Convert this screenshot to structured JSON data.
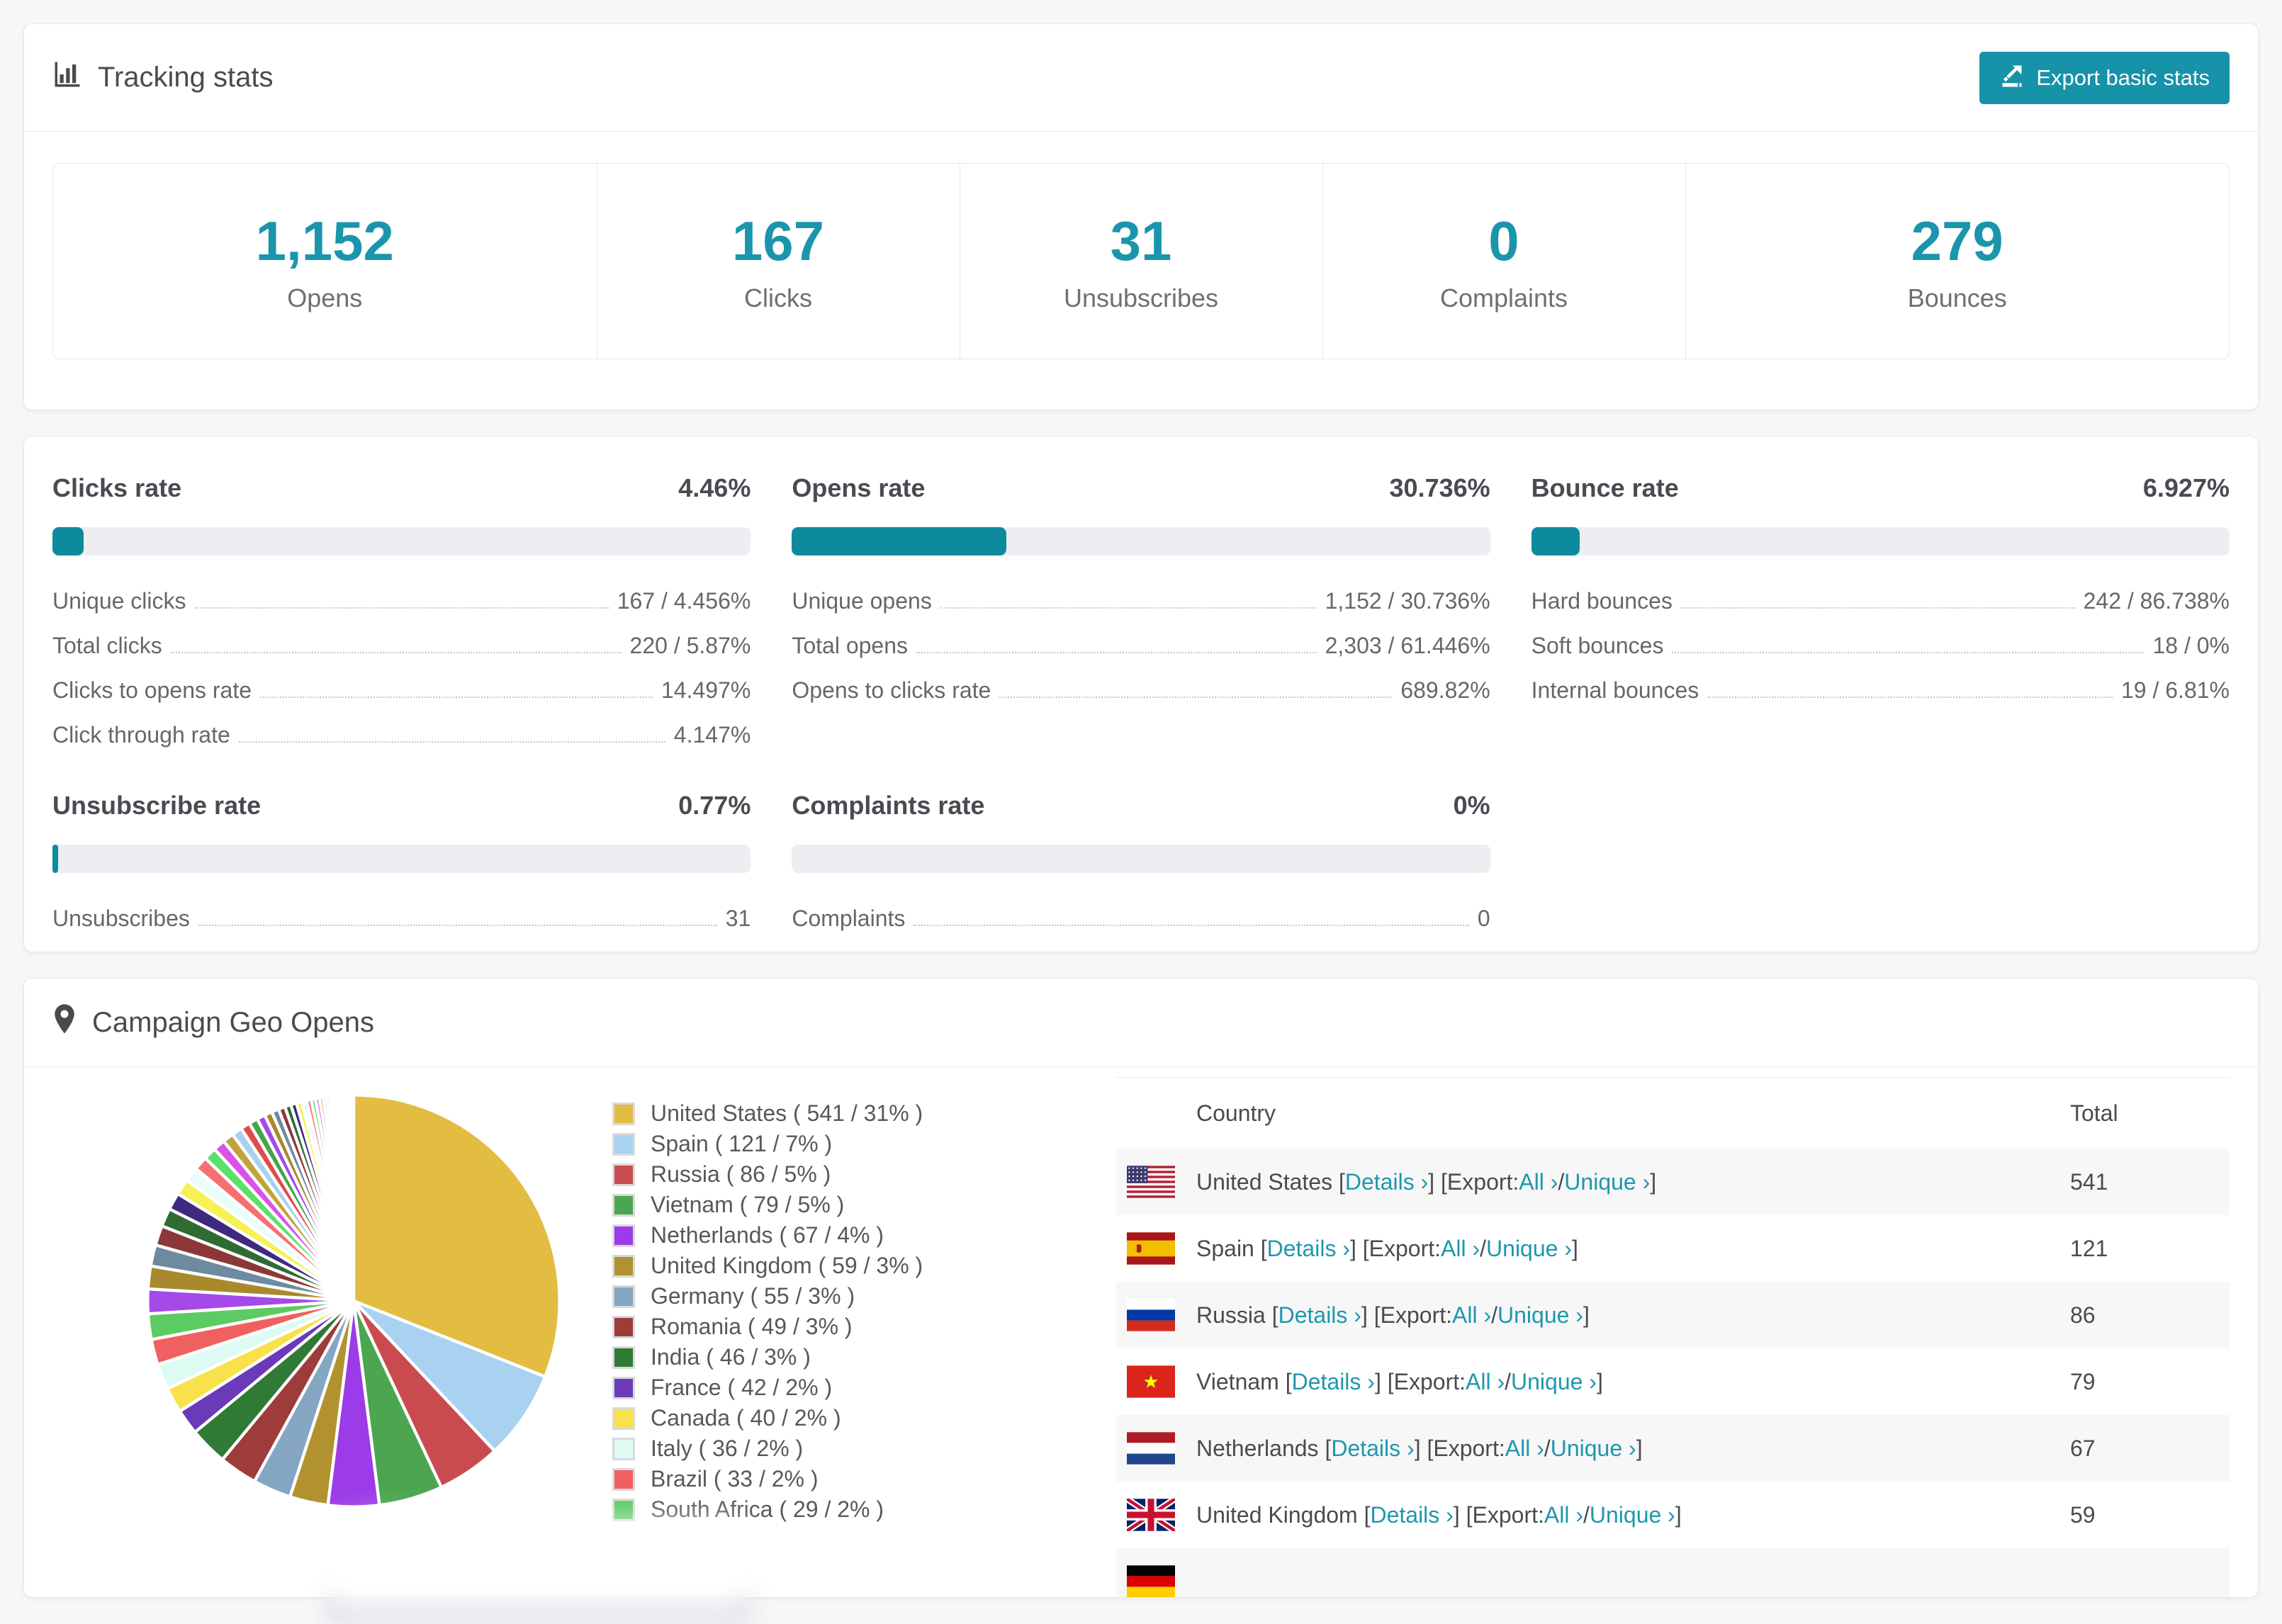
{
  "tracking": {
    "title": "Tracking stats",
    "export_label": "Export basic stats",
    "stats": [
      {
        "value": "1,152",
        "label": "Opens"
      },
      {
        "value": "167",
        "label": "Clicks"
      },
      {
        "value": "31",
        "label": "Unsubscribes"
      },
      {
        "value": "0",
        "label": "Complaints"
      },
      {
        "value": "279",
        "label": "Bounces"
      }
    ]
  },
  "rates": [
    {
      "title": "Clicks rate",
      "value": "4.46%",
      "percent": 4.46,
      "rows": [
        {
          "label": "Unique clicks",
          "value": "167 / 4.456%"
        },
        {
          "label": "Total clicks",
          "value": "220 / 5.87%"
        },
        {
          "label": "Clicks to opens rate",
          "value": "14.497%"
        },
        {
          "label": "Click through rate",
          "value": "4.147%"
        }
      ]
    },
    {
      "title": "Opens rate",
      "value": "30.736%",
      "percent": 30.736,
      "rows": [
        {
          "label": "Unique opens",
          "value": "1,152 / 30.736%"
        },
        {
          "label": "Total opens",
          "value": "2,303 / 61.446%"
        },
        {
          "label": "Opens to clicks rate",
          "value": "689.82%"
        }
      ]
    },
    {
      "title": "Bounce rate",
      "value": "6.927%",
      "percent": 6.927,
      "rows": [
        {
          "label": "Hard bounces",
          "value": "242 / 86.738%"
        },
        {
          "label": "Soft bounces",
          "value": "18 / 0%"
        },
        {
          "label": "Internal bounces",
          "value": "19 / 6.81%"
        }
      ]
    },
    {
      "title": "Unsubscribe rate",
      "value": "0.77%",
      "percent": 0.77,
      "rows": [
        {
          "label": "Unsubscribes",
          "value": "31"
        }
      ]
    },
    {
      "title": "Complaints rate",
      "value": "0%",
      "percent": 0,
      "rows": [
        {
          "label": "Complaints",
          "value": "0"
        }
      ]
    }
  ],
  "geo": {
    "title": "Campaign Geo Opens",
    "chart_data": {
      "type": "pie",
      "title": "Campaign Geo Opens",
      "start_angle_deg": 0,
      "direction": "clockwise",
      "legend_position": "right",
      "series": [
        {
          "name": "United States",
          "value": 541,
          "percent": 31,
          "color": "#E3BC42"
        },
        {
          "name": "Spain",
          "value": 121,
          "percent": 7,
          "color": "#A8D2F0"
        },
        {
          "name": "Russia",
          "value": 86,
          "percent": 5,
          "color": "#C94B50"
        },
        {
          "name": "Vietnam",
          "value": 79,
          "percent": 5,
          "color": "#4CA64F"
        },
        {
          "name": "Netherlands",
          "value": 67,
          "percent": 4,
          "color": "#9C3BE8"
        },
        {
          "name": "United Kingdom",
          "value": 59,
          "percent": 3,
          "color": "#B2922F"
        },
        {
          "name": "Germany",
          "value": 55,
          "percent": 3,
          "color": "#84A6C2"
        },
        {
          "name": "Romania",
          "value": 49,
          "percent": 3,
          "color": "#9E3B3B"
        },
        {
          "name": "India",
          "value": 46,
          "percent": 3,
          "color": "#2F7A34"
        },
        {
          "name": "France",
          "value": 42,
          "percent": 2,
          "color": "#6B3AB8"
        },
        {
          "name": "Canada",
          "value": 40,
          "percent": 2,
          "color": "#F8E14B"
        },
        {
          "name": "Italy",
          "value": 36,
          "percent": 2,
          "color": "#DDFBF3"
        },
        {
          "name": "Brazil",
          "value": 33,
          "percent": 2,
          "color": "#F06060"
        },
        {
          "name": "South Africa",
          "value": 29,
          "percent": 2,
          "color": "#5BCB62"
        }
      ],
      "others_total_percent": 26,
      "others_palette": [
        "#A44AE8",
        "#A8892C",
        "#6E8AA0",
        "#8C3838",
        "#2F6B33",
        "#3F2A80",
        "#F6F155",
        "#EAFDFB",
        "#F77070",
        "#5DE06A",
        "#DA52E8",
        "#C2A23A",
        "#A8D1F0",
        "#E04B4B",
        "#47A34C"
      ]
    },
    "legend": [
      {
        "label": "United States ( 541 / 31% )",
        "color": "#E3BC42"
      },
      {
        "label": "Spain ( 121 / 7% )",
        "color": "#A8D2F0"
      },
      {
        "label": "Russia ( 86 / 5% )",
        "color": "#C94B50"
      },
      {
        "label": "Vietnam ( 79 / 5% )",
        "color": "#4CA64F"
      },
      {
        "label": "Netherlands ( 67 / 4% )",
        "color": "#9C3BE8"
      },
      {
        "label": "United Kingdom ( 59 / 3% )",
        "color": "#B2922F"
      },
      {
        "label": "Germany ( 55 / 3% )",
        "color": "#84A6C2"
      },
      {
        "label": "Romania ( 49 / 3% )",
        "color": "#9E3B3B"
      },
      {
        "label": "India ( 46 / 3% )",
        "color": "#2F7A34"
      },
      {
        "label": "France ( 42 / 2% )",
        "color": "#6B3AB8"
      },
      {
        "label": "Canada ( 40 / 2% )",
        "color": "#F8E14B"
      },
      {
        "label": "Italy ( 36 / 2% )",
        "color": "#DDFBF3"
      },
      {
        "label": "Brazil ( 33 / 2% )",
        "color": "#F06060"
      },
      {
        "label": "South Africa ( 29 / 2% )",
        "color": "#5BCB62"
      }
    ],
    "table": {
      "headers": [
        "Country",
        "Total"
      ],
      "labels": {
        "details": "Details ›",
        "export": "Export:",
        "all": "All ›",
        "unique": "Unique ›"
      },
      "brackets": {
        "open": "[",
        "close": "]",
        "slash": "/"
      },
      "rows": [
        {
          "country": "United States",
          "flag": "us",
          "total": "541"
        },
        {
          "country": "Spain",
          "flag": "es",
          "total": "121"
        },
        {
          "country": "Russia",
          "flag": "ru",
          "total": "86"
        },
        {
          "country": "Vietnam",
          "flag": "vn",
          "total": "79"
        },
        {
          "country": "Netherlands",
          "flag": "nl",
          "total": "67"
        },
        {
          "country": "United Kingdom",
          "flag": "gb",
          "total": "59"
        }
      ],
      "partial_row": {
        "flag": "de"
      }
    }
  }
}
